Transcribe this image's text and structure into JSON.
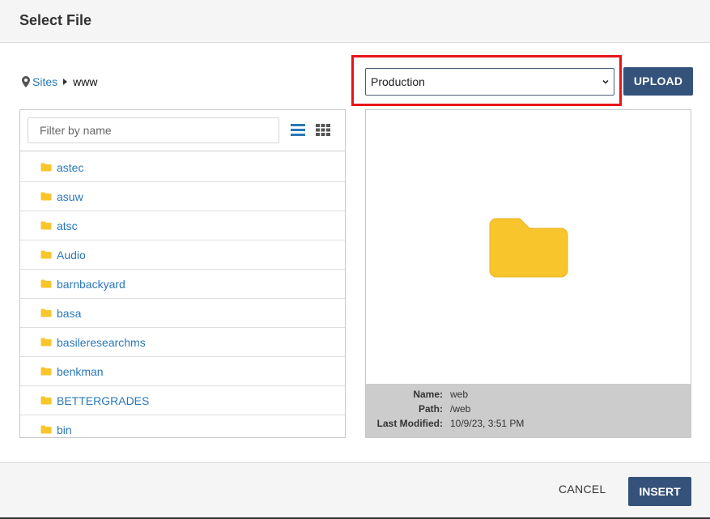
{
  "dialog": {
    "title": "Select File"
  },
  "breadcrumb": {
    "root": "Sites",
    "current": "www",
    "root_icon": "map-marker-icon",
    "separator_icon": "caret-right-icon"
  },
  "environment_select": {
    "selected": "Production"
  },
  "toolbar": {
    "upload_label": "UPLOAD"
  },
  "file_list": {
    "filter_placeholder": "Filter by name",
    "view_modes": [
      "list-view-icon",
      "grid-view-icon"
    ],
    "active_view": "list",
    "items": [
      {
        "name": "astec",
        "type": "folder"
      },
      {
        "name": "asuw",
        "type": "folder"
      },
      {
        "name": "atsc",
        "type": "folder"
      },
      {
        "name": "Audio",
        "type": "folder"
      },
      {
        "name": "barnbackyard",
        "type": "folder"
      },
      {
        "name": "basa",
        "type": "folder"
      },
      {
        "name": "basileresearchms",
        "type": "folder"
      },
      {
        "name": "benkman",
        "type": "folder"
      },
      {
        "name": "BETTERGRADES",
        "type": "folder"
      },
      {
        "name": "bin",
        "type": "folder"
      }
    ]
  },
  "preview": {
    "icon": "folder-icon",
    "name_label": "Name:",
    "name_value": "web",
    "path_label": "Path:",
    "path_value": "/web",
    "modified_label": "Last Modified:",
    "modified_value": "10/9/23, 3:51 PM"
  },
  "footer": {
    "cancel_label": "CANCEL",
    "insert_label": "INSERT"
  },
  "colors": {
    "primary": "#34527a",
    "link": "#2a78b8",
    "folder": "#f8c52c",
    "highlight": "#e8141b"
  }
}
